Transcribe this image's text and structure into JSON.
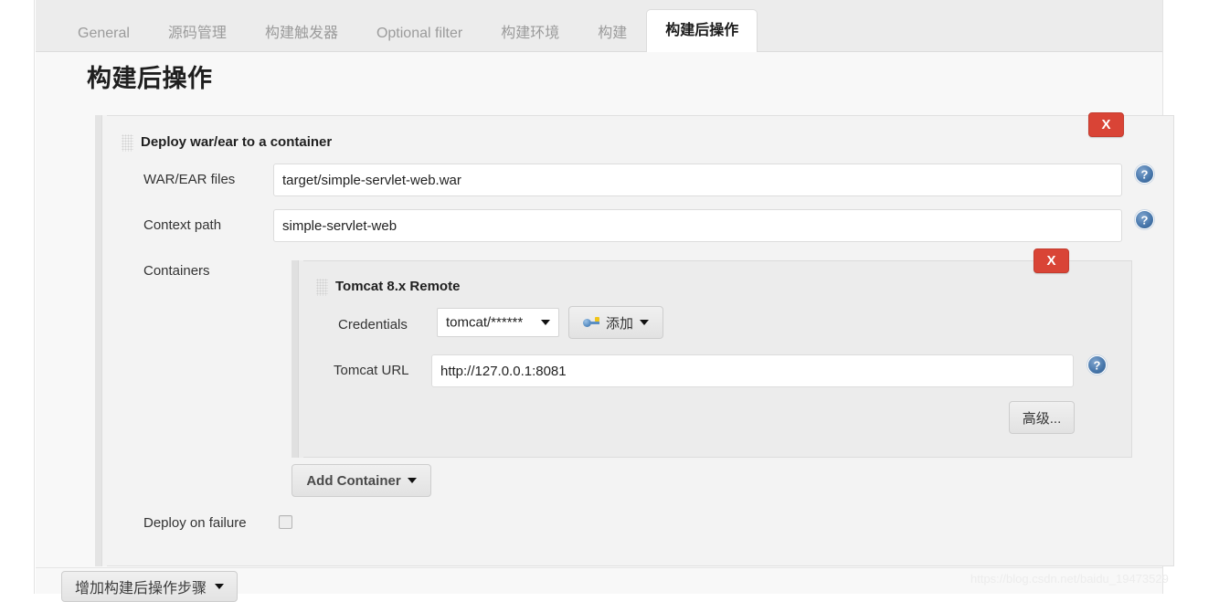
{
  "tabs": [
    {
      "label": "General",
      "active": false
    },
    {
      "label": "源码管理",
      "active": false
    },
    {
      "label": "构建触发器",
      "active": false
    },
    {
      "label": "Optional filter",
      "active": false
    },
    {
      "label": "构建环境",
      "active": false
    },
    {
      "label": "构建",
      "active": false
    },
    {
      "label": "构建后操作",
      "active": true
    }
  ],
  "page": {
    "heading": "构建后操作"
  },
  "publisher": {
    "title": "Deploy war/ear to a container",
    "delete_label": "X",
    "fields": {
      "war_label": "WAR/EAR files",
      "war_value": "target/simple-servlet-web.war",
      "context_label": "Context path",
      "context_value": "simple-servlet-web",
      "containers_label": "Containers",
      "deploy_on_failure_label": "Deploy on failure",
      "deploy_on_failure_checked": false
    },
    "container": {
      "title": "Tomcat 8.x Remote",
      "delete_label": "X",
      "credentials_label": "Credentials",
      "credentials_value": "tomcat/******",
      "add_credentials_label": "添加",
      "url_label": "Tomcat URL",
      "url_value": "http://127.0.0.1:8081",
      "advanced_label": "高级..."
    },
    "add_container_label": "Add Container"
  },
  "footer": {
    "add_step_label": "增加构建后操作步骤"
  },
  "watermark": "https://blog.csdn.net/baidu_19473529",
  "colors": {
    "delete_red": "#d94436",
    "help_blue": "#4a79ad",
    "panel_bg": "#f3f3f3",
    "inner_panel_bg": "#ececec",
    "tabbar_bg": "#ececec"
  }
}
